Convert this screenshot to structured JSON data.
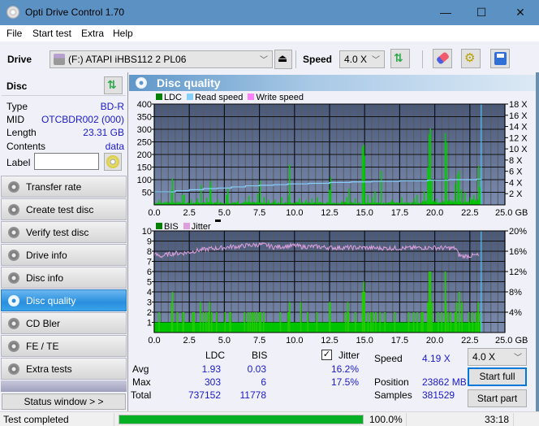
{
  "window": {
    "title": "Opti Drive Control 1.70",
    "minimize": "—",
    "maximize": "☐",
    "close": "✕"
  },
  "menu": [
    "File",
    "Start test",
    "Extra",
    "Help"
  ],
  "toolbar": {
    "drive_label": "Drive",
    "drive_value": "(F:)   ATAPI iHBS112   2 PL06",
    "speed_label": "Speed",
    "speed_value": "4.0 X"
  },
  "disc": {
    "header": "Disc",
    "fields": [
      {
        "key": "Type",
        "value": "BD-R"
      },
      {
        "key": "MID",
        "value": "OTCBDR002 (000)"
      },
      {
        "key": "Length",
        "value": "23.31 GB"
      },
      {
        "key": "Contents",
        "value": "data"
      }
    ],
    "label_key": "Label",
    "label_value": ""
  },
  "nav": [
    {
      "label": "Transfer rate",
      "active": false
    },
    {
      "label": "Create test disc",
      "active": false
    },
    {
      "label": "Verify test disc",
      "active": false
    },
    {
      "label": "Drive info",
      "active": false
    },
    {
      "label": "Disc info",
      "active": false
    },
    {
      "label": "Disc quality",
      "active": true
    },
    {
      "label": "CD Bler",
      "active": false
    },
    {
      "label": "FE / TE",
      "active": false
    },
    {
      "label": "Extra tests",
      "active": false
    }
  ],
  "status_window_button": "Status window > >",
  "panel_title": "Disc quality",
  "chart_data": [
    {
      "type": "bar",
      "title": "LDC / Read speed",
      "legend": [
        {
          "name": "LDC",
          "color": "#008000"
        },
        {
          "name": "Read speed",
          "color": "#87cefa"
        },
        {
          "name": "Write speed",
          "color": "#ff80ff"
        }
      ],
      "xlabel": "GB",
      "x_ticks": [
        "0.0",
        "2.5",
        "5.0",
        "7.5",
        "10.0",
        "12.5",
        "15.0",
        "17.5",
        "20.0",
        "22.5",
        "25.0 GB"
      ],
      "xlim": [
        0,
        25
      ],
      "ylim": [
        0,
        400
      ],
      "y_ticks": [
        "400",
        "350",
        "300",
        "250",
        "200",
        "150",
        "100",
        "50"
      ],
      "y2_ticks": [
        "18 X",
        "16 X",
        "14 X",
        "12 X",
        "10 X",
        "8 X",
        "6 X",
        "4 X",
        "2 X"
      ],
      "y2lim": [
        0,
        18
      ],
      "grid": true,
      "end_marker_gb": 23.31,
      "ldc_spikes": [
        [
          0.3,
          20
        ],
        [
          0.75,
          12
        ],
        [
          1.2,
          60
        ],
        [
          1.25,
          105
        ],
        [
          1.6,
          15
        ],
        [
          1.95,
          40
        ],
        [
          2.1,
          40
        ],
        [
          2.6,
          20
        ],
        [
          3.05,
          25
        ],
        [
          3.3,
          80
        ],
        [
          3.7,
          28
        ],
        [
          3.95,
          75
        ],
        [
          4.0,
          95
        ],
        [
          4.5,
          20
        ],
        [
          5.1,
          40
        ],
        [
          5.2,
          65
        ],
        [
          5.9,
          15
        ],
        [
          6.45,
          20
        ],
        [
          6.7,
          35
        ],
        [
          7.35,
          45
        ],
        [
          7.5,
          95
        ],
        [
          7.8,
          30
        ],
        [
          8.1,
          20
        ],
        [
          8.6,
          20
        ],
        [
          9.05,
          30
        ],
        [
          9.55,
          35
        ],
        [
          9.6,
          160
        ],
        [
          10.3,
          25
        ],
        [
          10.8,
          20
        ],
        [
          11.2,
          25
        ],
        [
          11.6,
          30
        ],
        [
          12.45,
          60
        ],
        [
          12.55,
          110
        ],
        [
          13.3,
          15
        ],
        [
          13.7,
          30
        ],
        [
          13.85,
          65
        ],
        [
          14.3,
          25
        ],
        [
          14.8,
          230
        ],
        [
          14.9,
          240
        ],
        [
          14.95,
          195
        ],
        [
          15.2,
          40
        ],
        [
          15.5,
          30
        ],
        [
          15.7,
          55
        ],
        [
          16.15,
          135
        ],
        [
          16.9,
          20
        ],
        [
          17.6,
          30
        ],
        [
          18.5,
          25
        ],
        [
          18.7,
          40
        ],
        [
          19.2,
          55
        ],
        [
          19.45,
          150
        ],
        [
          19.55,
          280
        ],
        [
          19.65,
          303
        ],
        [
          19.75,
          100
        ],
        [
          20.1,
          25
        ],
        [
          20.7,
          285
        ],
        [
          20.8,
          250
        ],
        [
          21.05,
          20
        ],
        [
          21.4,
          85
        ],
        [
          21.6,
          120
        ],
        [
          21.7,
          135
        ],
        [
          21.85,
          60
        ],
        [
          22.1,
          50
        ],
        [
          22.5,
          30
        ],
        [
          22.75,
          40
        ],
        [
          23.1,
          155
        ],
        [
          23.2,
          70
        ]
      ],
      "read_speed_steps": [
        [
          0.0,
          2.3
        ],
        [
          1.5,
          2.5
        ],
        [
          2.5,
          2.7
        ],
        [
          3.5,
          2.9
        ],
        [
          4.5,
          3.0
        ],
        [
          5.5,
          3.2
        ],
        [
          6.5,
          3.4
        ],
        [
          7.5,
          3.5
        ],
        [
          8.5,
          3.6
        ],
        [
          9.5,
          3.75
        ],
        [
          11.0,
          3.85
        ],
        [
          12.5,
          4.0
        ],
        [
          14.0,
          4.1
        ],
        [
          15.5,
          4.2
        ],
        [
          17.5,
          4.3
        ],
        [
          19.5,
          4.4
        ],
        [
          21.0,
          4.5
        ],
        [
          23.0,
          4.6
        ],
        [
          23.31,
          4.75
        ]
      ]
    },
    {
      "type": "bar",
      "title": "BIS / Jitter",
      "legend": [
        {
          "name": "BIS",
          "color": "#008000"
        },
        {
          "name": "Jitter",
          "color": "#dda0dd"
        }
      ],
      "xlabel": "GB",
      "x_ticks": [
        "0.0",
        "2.5",
        "5.0",
        "7.5",
        "10.0",
        "12.5",
        "15.0",
        "17.5",
        "20.0",
        "22.5",
        "25.0 GB"
      ],
      "xlim": [
        0,
        25
      ],
      "ylim": [
        0,
        10
      ],
      "y_ticks": [
        "10",
        "9",
        "8",
        "7",
        "6",
        "5",
        "4",
        "3",
        "2",
        "1"
      ],
      "y2_ticks": [
        "20%",
        "16%",
        "12%",
        "8%",
        "4%"
      ],
      "y2lim": [
        0,
        20
      ],
      "grid": true,
      "end_marker_gb": 23.31,
      "bis_baseline": 1,
      "bis_spikes": [
        [
          0.3,
          2
        ],
        [
          1.2,
          3
        ],
        [
          1.25,
          4
        ],
        [
          1.6,
          2
        ],
        [
          2.0,
          2
        ],
        [
          2.05,
          2
        ],
        [
          2.7,
          2
        ],
        [
          2.8,
          2
        ],
        [
          3.25,
          3
        ],
        [
          3.45,
          2
        ],
        [
          3.65,
          2
        ],
        [
          3.8,
          2
        ],
        [
          3.9,
          3
        ],
        [
          4.05,
          2
        ],
        [
          4.4,
          2
        ],
        [
          5.0,
          2
        ],
        [
          5.35,
          2
        ],
        [
          5.4,
          2
        ],
        [
          6.4,
          2
        ],
        [
          6.65,
          2
        ],
        [
          6.8,
          2
        ],
        [
          6.95,
          2
        ],
        [
          7.1,
          2
        ],
        [
          7.25,
          2
        ],
        [
          7.45,
          2
        ],
        [
          7.55,
          2
        ],
        [
          7.75,
          2
        ],
        [
          8.95,
          2
        ],
        [
          9.5,
          2
        ],
        [
          9.55,
          2
        ],
        [
          9.6,
          3
        ],
        [
          10.4,
          3
        ],
        [
          10.9,
          2
        ],
        [
          11.55,
          2
        ],
        [
          12.45,
          3
        ],
        [
          12.5,
          3
        ],
        [
          13.6,
          2
        ],
        [
          13.75,
          3
        ],
        [
          13.8,
          2
        ],
        [
          14.3,
          2
        ],
        [
          14.8,
          4
        ],
        [
          14.9,
          5
        ],
        [
          14.95,
          4
        ],
        [
          15.2,
          2
        ],
        [
          15.4,
          2
        ],
        [
          15.55,
          2
        ],
        [
          15.75,
          2
        ],
        [
          16.05,
          2
        ],
        [
          16.4,
          2
        ],
        [
          17.1,
          2
        ],
        [
          18.1,
          2
        ],
        [
          18.45,
          2
        ],
        [
          18.7,
          2
        ],
        [
          19.0,
          2
        ],
        [
          19.1,
          2
        ],
        [
          19.45,
          3
        ],
        [
          19.55,
          6
        ],
        [
          19.65,
          6
        ],
        [
          19.75,
          3
        ],
        [
          20.2,
          2
        ],
        [
          20.45,
          2
        ],
        [
          20.7,
          6
        ],
        [
          20.75,
          3
        ],
        [
          20.9,
          2
        ],
        [
          21.1,
          2
        ],
        [
          21.4,
          2
        ],
        [
          21.5,
          3
        ],
        [
          21.7,
          4
        ],
        [
          21.9,
          3
        ],
        [
          22.4,
          2
        ],
        [
          22.65,
          2
        ],
        [
          22.9,
          2
        ],
        [
          23.05,
          3
        ],
        [
          23.2,
          2
        ]
      ],
      "jitter_profile": [
        [
          0.0,
          15.4
        ],
        [
          0.5,
          15.0
        ],
        [
          1.0,
          15.4
        ],
        [
          1.5,
          15.6
        ],
        [
          2.0,
          15.6
        ],
        [
          2.5,
          15.8
        ],
        [
          3.0,
          16.1
        ],
        [
          3.5,
          16.3
        ],
        [
          4.0,
          16.5
        ],
        [
          4.5,
          16.6
        ],
        [
          5.0,
          16.7
        ],
        [
          5.5,
          16.9
        ],
        [
          6.0,
          16.9
        ],
        [
          6.5,
          17.1
        ],
        [
          7.0,
          17.2
        ],
        [
          7.5,
          17.3
        ],
        [
          8.0,
          17.2
        ],
        [
          8.5,
          16.8
        ],
        [
          9.0,
          16.9
        ],
        [
          9.5,
          17.0
        ],
        [
          10.0,
          17.1
        ],
        [
          10.5,
          16.9
        ],
        [
          11.0,
          16.9
        ],
        [
          11.5,
          16.9
        ],
        [
          12.0,
          16.8
        ],
        [
          12.5,
          16.7
        ],
        [
          13.0,
          16.7
        ],
        [
          14.0,
          16.7
        ],
        [
          15.0,
          16.7
        ],
        [
          16.0,
          16.6
        ],
        [
          17.0,
          16.6
        ],
        [
          18.0,
          16.6
        ],
        [
          19.0,
          16.7
        ],
        [
          20.0,
          16.7
        ],
        [
          21.0,
          16.6
        ],
        [
          21.5,
          16.6
        ],
        [
          21.7,
          15.3
        ],
        [
          22.0,
          15.0
        ],
        [
          22.5,
          15.1
        ],
        [
          23.0,
          15.2
        ],
        [
          23.2,
          15.1
        ]
      ]
    }
  ],
  "stats": {
    "col_ldc": "LDC",
    "col_bis": "BIS",
    "row_avg": "Avg",
    "row_max": "Max",
    "row_total": "Total",
    "ldc_avg": "1.93",
    "ldc_max": "303",
    "ldc_total": "737152",
    "bis_avg": "0.03",
    "bis_max": "6",
    "bis_total": "11778",
    "jitter_label": "Jitter",
    "jitter_checked": true,
    "jitter_avg": "16.2%",
    "jitter_max": "17.5%",
    "speed_label": "Speed",
    "speed_value": "4.19 X",
    "position_label": "Position",
    "position_value": "23862 MB",
    "samples_label": "Samples",
    "samples_value": "381529",
    "speed_select": "4.0 X",
    "start_full": "Start full",
    "start_part": "Start part"
  },
  "statusbar": {
    "text": "Test completed",
    "progress_percent": 100.0,
    "progress_label": "100.0%",
    "elapsed": "33:18"
  }
}
